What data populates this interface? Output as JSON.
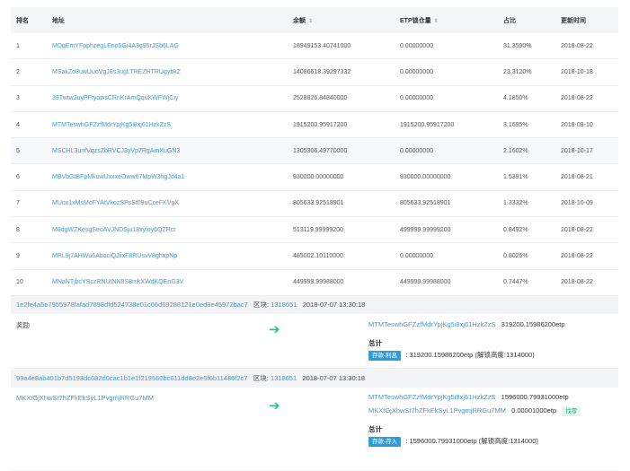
{
  "rich_list": {
    "headers": {
      "rank": "排名",
      "address": "地址",
      "balance": "余额",
      "etp_locked": "ETP锁仓量",
      "ratio": "占比",
      "updated": "更新时间"
    },
    "rows": [
      {
        "rank": "1",
        "address": "MDqEmYFpphzegLEno5Gi4A3g95rJSb6LAG",
        "balance": "18949153.40741000",
        "locked": "0.00000000",
        "ratio": "31.3590%",
        "updated": "2018-08-22"
      },
      {
        "rank": "2",
        "address": "MSakZo8uwUuoVgJ8s3ugLTREZHTRUgybkZ",
        "balance": "14086618.39297332",
        "locked": "0.00000000",
        "ratio": "23.3120%",
        "updated": "2018-10-18"
      },
      {
        "rank": "3",
        "address": "39Twtw2uyPFtyowsCRnKrAmQquKWFWjCiy",
        "balance": "2528826.84840000",
        "locked": "0.00000000",
        "ratio": "4.1850%",
        "updated": "2018-08-22"
      },
      {
        "rank": "4",
        "address": "MTMTeswhGFZzfMdrYpjKg5i8xj61HzkZzS",
        "balance": "1915200.95917200",
        "locked": "1915200.95917200",
        "ratio": "3.1695%",
        "updated": "2018-09-10"
      },
      {
        "rank": "5",
        "address": "MSCHL3unfVqzsZbRVCJ3yVp7RgAmXuGN3",
        "balance": "1305306.49770000",
        "locked": "0.00000000",
        "ratio": "2.1602%",
        "updated": "2018-10-17"
      },
      {
        "rank": "6",
        "address": "MBVbGtBFpMkuwUxxxeOww67MpW3hgJd4a1",
        "balance": "930000.00000000",
        "locked": "930000.00000000",
        "ratio": "1.5391%",
        "updated": "2018-08-21"
      },
      {
        "rank": "7",
        "address": "MUox1xMsMoFYAtVkozSPsSt09uCceFKVgX",
        "balance": "805633.92518901",
        "locked": "805633.92518901",
        "ratio": "1.3332%",
        "updated": "2018-10-09"
      },
      {
        "rank": "8",
        "address": "M8dgWZKesgSeoAVJNDSju18xyloy6QZRcr",
        "balance": "513119.99999200",
        "locked": "499999.99999200",
        "ratio": "0.8492%",
        "updated": "2018-08-22"
      },
      {
        "rank": "9",
        "address": "MRL9j7AHWu6AbociQJiixF8RUsvV8ghxpNp",
        "balance": "485002.10110000",
        "locked": "0.00000000",
        "ratio": "0.8026%",
        "updated": "2018-08-22"
      },
      {
        "rank": "10",
        "address": "MNaNTjbcYSczRNUtNN8S8mkXWdKQEnG3V",
        "balance": "449999.99988000",
        "locked": "449999.99988000",
        "ratio": "0.7447%",
        "updated": "2018-08-22"
      }
    ]
  },
  "tx1": {
    "hash": "1e2fe4a5e7955978fafad7898dfd524738e01c66d69288121e0ed8e45972bac7",
    "block_label": "区块:",
    "block": "1318651",
    "time": "2018-07-07 13:30:18",
    "source": "奖励",
    "output_address": "MTMTeswhGFZzfMdrYpjKg5i8xj61HzkZzS",
    "output_amount": "319200.15986200etp",
    "total_label": "总计",
    "tag": "存款-利息",
    "total_text": ": 319200.15986200etp (解锁高度:1314000)"
  },
  "tx2": {
    "hash": "99a4e8ab401b7d5193dc682d0cac1b1e1f219560bc611dd8e2e5f6b11486f2c7",
    "block_label": "区块:",
    "block": "1318651",
    "time": "2018-07-07 13:30:18",
    "source": "MKXtGjXhwSt7hZFkEkSyL1PvgmjRRGu7MM",
    "outputs": [
      {
        "address": "MTMTeswhGFZzfMdrYpjKg5i8xj61HzkZzS",
        "amount": "1596000.79931000etp"
      },
      {
        "address": "MKXtGjXhwSt7hZFkEkSyL1PvgmjRRGu7MM",
        "amount": "0.00001000etp",
        "tag": "找零"
      }
    ],
    "total_label": "总计",
    "tag": "存款-存入",
    "total_text": ": 1596000.79931000etp (解锁高度:1314000)"
  },
  "icons": {
    "sort": "sort-arrows-icon",
    "arrow": "right-arrow-icon"
  },
  "colors": {
    "link": "#4a95c8",
    "arrow": "#2cc08a",
    "pill": "#2d9cdb",
    "header_bg": "#f5f6f8"
  }
}
